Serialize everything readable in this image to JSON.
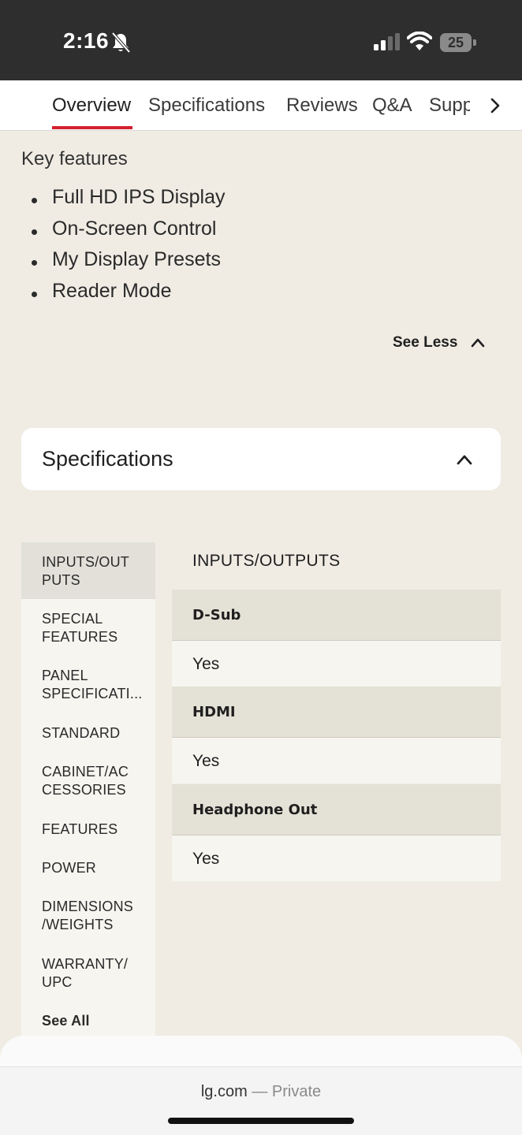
{
  "status": {
    "time": "2:16",
    "battery": "25",
    "icons": [
      "bell-slash-icon",
      "signal-icon",
      "wifi-icon",
      "battery-icon"
    ]
  },
  "tabs": [
    {
      "label": "Overview",
      "active": true
    },
    {
      "label": "Specifications"
    },
    {
      "label": "Reviews"
    },
    {
      "label": "Q&A"
    },
    {
      "label": "Supp"
    }
  ],
  "key_features": {
    "title": "Key features",
    "items": [
      "Full HD IPS Display",
      "On-Screen Control",
      "My Display Presets",
      "Reader Mode"
    ],
    "see_less": "See Less"
  },
  "specifications": {
    "card_title": "Specifications",
    "nav": [
      {
        "label": "INPUTS/OUT PUTS",
        "lines": [
          "INPUTS/OUT",
          "PUTS"
        ],
        "active": true
      },
      {
        "lines": [
          "SPECIAL",
          "FEATURES"
        ]
      },
      {
        "lines": [
          "PANEL",
          "SPECIFICATI..."
        ]
      },
      {
        "lines": [
          "STANDARD"
        ]
      },
      {
        "lines": [
          "CABINET/AC",
          "CESSORIES"
        ]
      },
      {
        "lines": [
          "FEATURES"
        ]
      },
      {
        "lines": [
          "POWER"
        ]
      },
      {
        "lines": [
          "DIMENSIONS",
          "/WEIGHTS"
        ]
      },
      {
        "lines": [
          "WARRANTY/",
          "UPC"
        ]
      },
      {
        "lines": [
          "See All"
        ]
      }
    ],
    "section_title": "INPUTS/OUTPUTS",
    "rows": [
      {
        "label": "D-Sub",
        "value": "Yes"
      },
      {
        "label": "HDMI",
        "value": "Yes"
      },
      {
        "label": "Headphone Out",
        "value": "Yes"
      }
    ]
  },
  "browser": {
    "domain": "lg.com",
    "separator": " — ",
    "mode": "Private"
  },
  "colors": {
    "accent": "#d4202f",
    "status_bar": "#2e2e2e",
    "page_bg": "#f0ece4",
    "row_head_bg": "#e4e1d6"
  }
}
